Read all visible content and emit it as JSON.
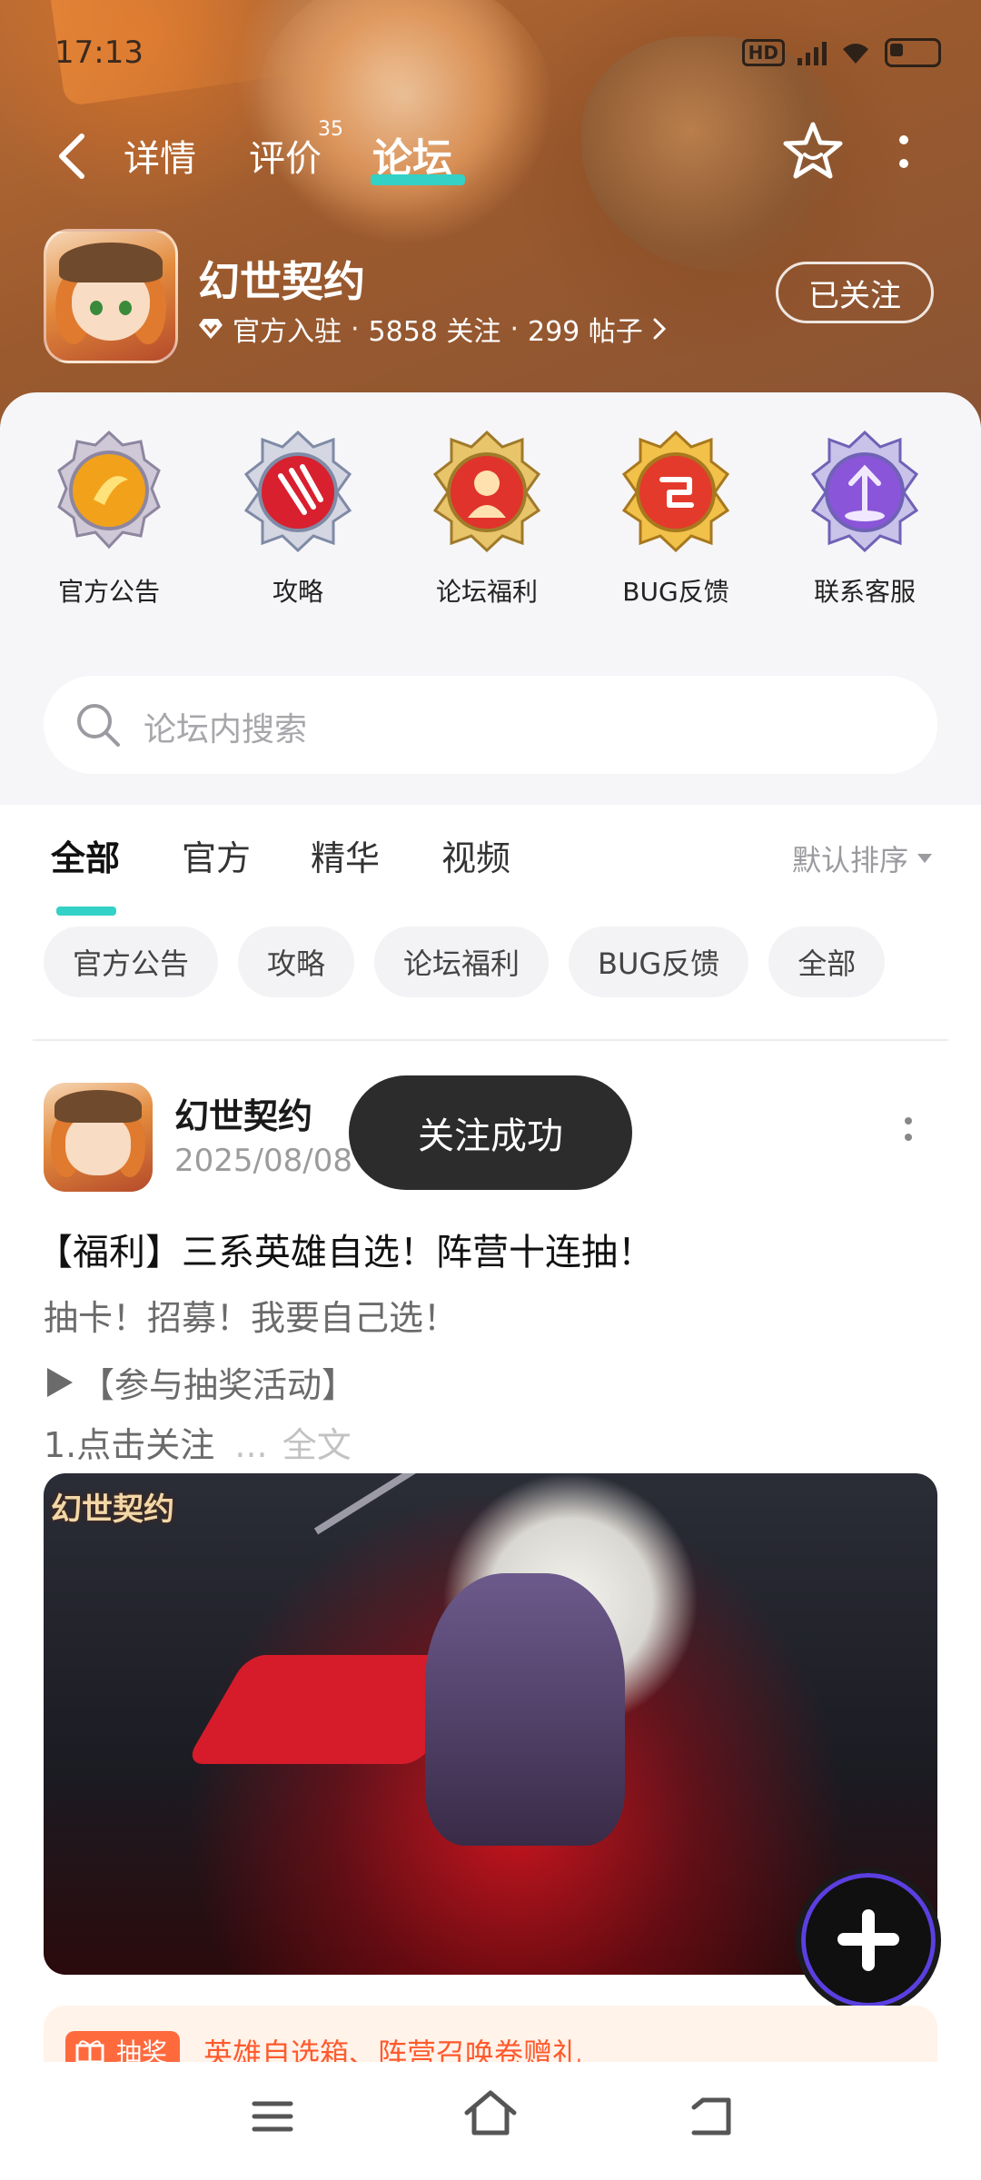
{
  "status_bar": {
    "time": "17:13",
    "hd_label": "HD",
    "network": "5G"
  },
  "nav": {
    "tabs": [
      {
        "label": "详情"
      },
      {
        "label": "评价",
        "badge": "35"
      },
      {
        "label": "论坛"
      }
    ],
    "active_tab": "论坛"
  },
  "game": {
    "title": "幻世契约",
    "official": "官方入驻",
    "followers": "5858 关注",
    "posts": "299 帖子",
    "separator": "·",
    "follow_button": "已关注"
  },
  "quick_links": [
    {
      "label": "官方公告",
      "icon": "announcement-badge-icon",
      "color": "#f2a21a"
    },
    {
      "label": "攻略",
      "icon": "guide-claw-badge-icon",
      "color": "#d8202e"
    },
    {
      "label": "论坛福利",
      "icon": "welfare-badge-icon",
      "color": "#e0332b"
    },
    {
      "label": "BUG反馈",
      "icon": "bug-feedback-badge-icon",
      "color": "#e43a2c"
    },
    {
      "label": "联系客服",
      "icon": "customer-service-badge-icon",
      "color": "#8a55d9"
    }
  ],
  "search": {
    "placeholder": "论坛内搜索"
  },
  "filter_tabs": [
    {
      "label": "全部"
    },
    {
      "label": "官方"
    },
    {
      "label": "精华"
    },
    {
      "label": "视频"
    }
  ],
  "sort": {
    "label": "默认排序"
  },
  "chips": [
    {
      "label": "官方公告"
    },
    {
      "label": "攻略"
    },
    {
      "label": "论坛福利"
    },
    {
      "label": "BUG反馈"
    },
    {
      "label": "全部"
    }
  ],
  "post": {
    "author": "幻世契约",
    "date": "2025/08/08",
    "title": "【福利】三系英雄自选！阵营十连抽！",
    "line1": "抽卡！招募！我要自己选！",
    "line2": "【参与抽奖活动】",
    "line3": "1.点击关注",
    "ellipsis": "...",
    "fulltext": "全文",
    "image_caption": "幻世契约"
  },
  "promo": {
    "tag": "抽奖",
    "text": "英雄自选箱、阵营召唤卷赠礼"
  },
  "toast": {
    "text": "关注成功"
  },
  "colors": {
    "accent": "#33d1c6",
    "banner": "#a8612f",
    "promo": "#ff6a3d"
  }
}
